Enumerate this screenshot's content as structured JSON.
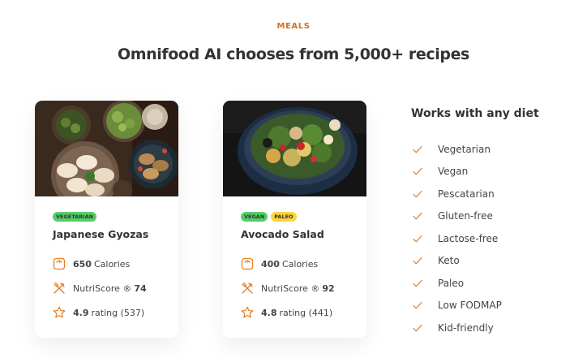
{
  "section": {
    "subheading": "MEALS",
    "heading": "Omnifood AI chooses from 5,000+ recipes"
  },
  "meals": [
    {
      "tags": [
        "VEGETARIAN"
      ],
      "title": "Japanese Gyozas",
      "calories_value": "650",
      "calories_label": "Calories",
      "nutri_label": "NutriScore ®",
      "nutri_value": "74",
      "rating_value": "4.9",
      "rating_label": "rating (537)"
    },
    {
      "tags": [
        "VEGAN",
        "PALEO"
      ],
      "title": "Avocado Salad",
      "calories_value": "400",
      "calories_label": "Calories",
      "nutri_label": "NutriScore ®",
      "nutri_value": "92",
      "rating_value": "4.8",
      "rating_label": "rating (441)"
    }
  ],
  "diets": {
    "title": "Works with any diet",
    "items": [
      "Vegetarian",
      "Vegan",
      "Pescatarian",
      "Gluten-free",
      "Lactose-free",
      "Keto",
      "Paleo",
      "Low FODMAP",
      "Kid-friendly"
    ]
  },
  "colors": {
    "accent": "#e67e22",
    "subheading": "#cf711f",
    "tag_vegetarian": "#51cf66",
    "tag_vegan": "#51cf66",
    "tag_paleo": "#ffd43b"
  },
  "icons": [
    "scale-icon",
    "utensils-icon",
    "star-icon",
    "checkmark-icon"
  ]
}
